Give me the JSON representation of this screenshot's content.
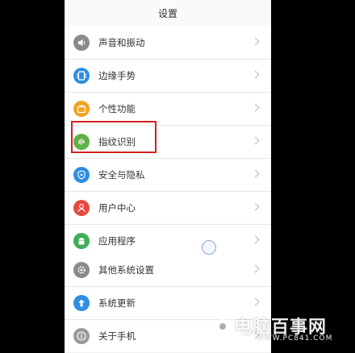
{
  "header": {
    "title": "设置"
  },
  "group1": {
    "items": [
      {
        "label": "声音和振动",
        "icon": "speaker-icon",
        "color": "#8a8a8a"
      },
      {
        "label": "边缘手势",
        "icon": "edge-gesture-icon",
        "color": "#2f8ee0"
      },
      {
        "label": "个性功能",
        "icon": "briefcase-icon",
        "color": "#f0a321"
      },
      {
        "label": "指纹识别",
        "icon": "fingerprint-icon",
        "color": "#5fb046"
      },
      {
        "label": "安全与隐私",
        "icon": "shield-icon",
        "color": "#2f8ee0"
      },
      {
        "label": "用户中心",
        "icon": "user-icon",
        "color": "#e8493c"
      },
      {
        "label": "应用程序",
        "icon": "android-icon",
        "color": "#3fae57"
      }
    ]
  },
  "group2": {
    "items": [
      {
        "label": "其他系统设置",
        "icon": "gear-icon",
        "color": "#8a8a8a"
      },
      {
        "label": "系统更新",
        "icon": "update-arrow-icon",
        "color": "#2f8ee0"
      },
      {
        "label": "关于手机",
        "icon": "info-icon",
        "color": "#9a9a9a"
      }
    ]
  },
  "watermark": {
    "name": "电脑百事网",
    "url": "WWW.PC841.COM"
  }
}
